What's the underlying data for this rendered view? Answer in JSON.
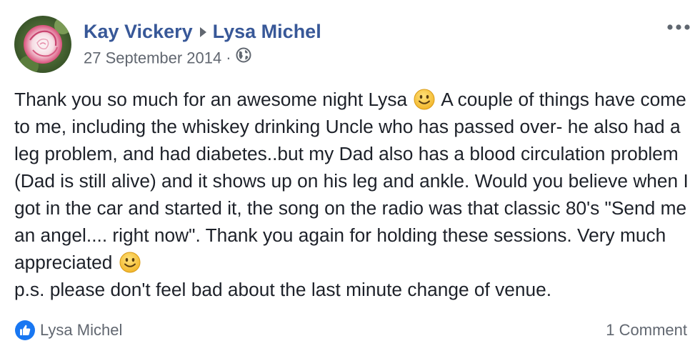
{
  "post": {
    "author": "Kay Vickery",
    "target": "Lysa Michel",
    "date": "27 September 2014",
    "separator": "·",
    "privacy_icon": "globe-icon",
    "menu_icon": "more-options-icon",
    "text_segments": {
      "s1": "Thank you so much for an awesome night Lysa",
      "s2": "A couple of things have come to me, including the whiskey drinking Uncle who has passed over- he also had a leg problem, and had diabetes..but my Dad also has a blood circulation problem (Dad is still alive) and it shows up on his leg and ankle. Would you believe when I got in the car and started it, the song on the radio was that classic 80's \"Send me an angel.... right now\". Thank you again for holding these sessions. Very much appreciated",
      "s3": "p.s. please don't feel bad about the last minute change of venue."
    },
    "reactions": {
      "icon": "like-icon",
      "names": "Lysa Michel"
    },
    "comments_label": "1 Comment"
  },
  "colors": {
    "link": "#385898",
    "meta": "#616770",
    "text": "#1d2129",
    "like_blue": "#1877f2",
    "smiley": "#f7c948"
  }
}
